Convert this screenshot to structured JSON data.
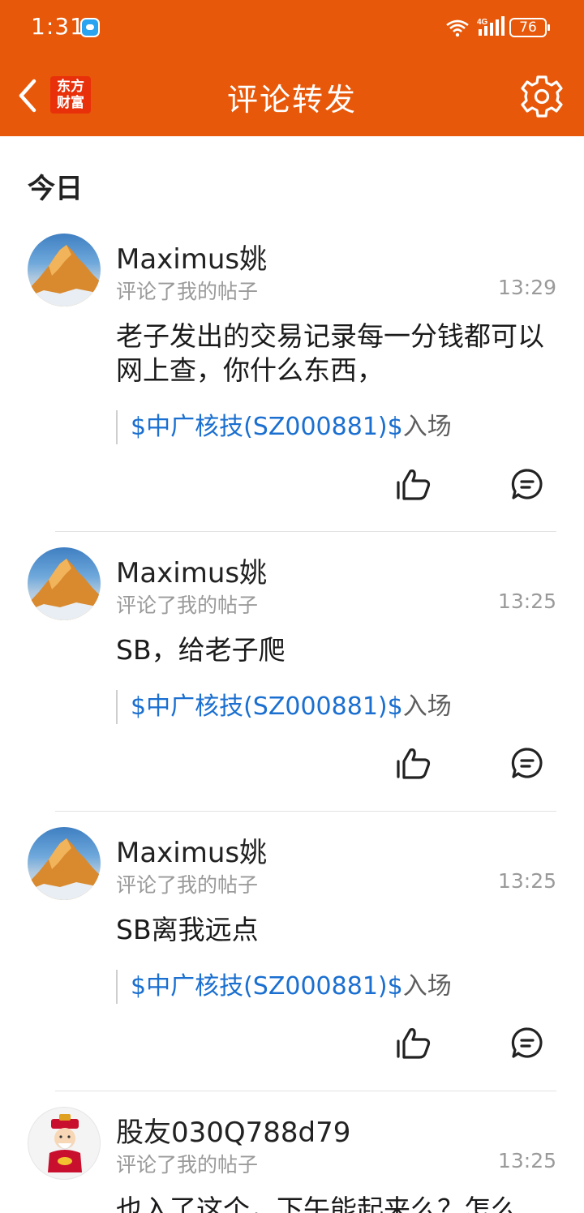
{
  "status_bar": {
    "time": "1:31",
    "battery": "76",
    "icons": [
      "message-notification-icon",
      "wifi-icon",
      "cellular-4g-signal-icon",
      "battery-icon"
    ]
  },
  "header": {
    "title": "评论转发",
    "logo_text_line1": "东方",
    "logo_text_line2": "财富",
    "colors": {
      "background": "#e8580a",
      "logo": "#e8300a"
    }
  },
  "section_title": "今日",
  "items": [
    {
      "username": "Maximus姚",
      "action": "评论了我的帖子",
      "time": "13:29",
      "content": "老子发出的交易记录每一分钱都可以网上查，你什么东西，",
      "quote_stock": "$中广核技(SZ000881)$",
      "quote_suffix": "入场",
      "avatar": "mountain-avatar"
    },
    {
      "username": "Maximus姚",
      "action": "评论了我的帖子",
      "time": "13:25",
      "content": "SB，给老子爬",
      "quote_stock": "$中广核技(SZ000881)$",
      "quote_suffix": "入场",
      "avatar": "mountain-avatar"
    },
    {
      "username": "Maximus姚",
      "action": "评论了我的帖子",
      "time": "13:25",
      "content": "SB离我远点",
      "quote_stock": "$中广核技(SZ000881)$",
      "quote_suffix": "入场",
      "avatar": "mountain-avatar"
    },
    {
      "username": "股友030Q788d79",
      "action": "评论了我的帖子",
      "time": "13:25",
      "content": "也入了这个，下午能起来么？怎么",
      "avatar": "god-of-wealth-avatar"
    }
  ],
  "colors": {
    "link": "#1a6fd0",
    "muted": "#9a9a9a"
  }
}
